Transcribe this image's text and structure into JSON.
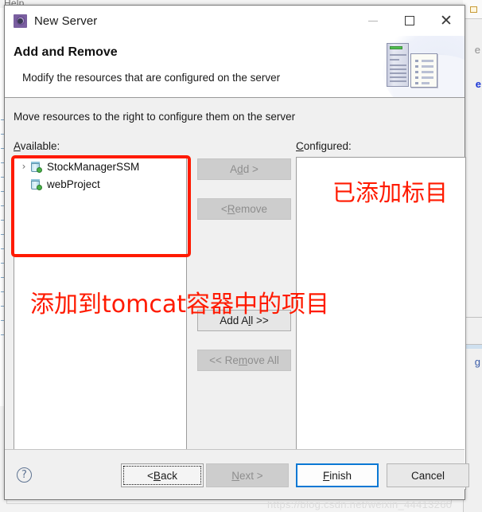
{
  "background": {
    "menu_help": "Help",
    "right_glyph_1": "e",
    "right_glyph_2": "e",
    "right_glyph_3": "g"
  },
  "window": {
    "title": "New Server",
    "icon": "server-wizard-icon",
    "controls": {
      "minimize": "minimize-icon",
      "maximize": "maximize-icon",
      "close": "close-icon"
    }
  },
  "header": {
    "title": "Add and Remove",
    "subtitle": "Modify the resources that are configured on the server",
    "art_icon": "server-rack-and-document-icon"
  },
  "main": {
    "instruction": "Move resources to the right to configure them on the server",
    "available": {
      "label": "Available:",
      "label_mnemonic": "A",
      "label_rest": "vailable:",
      "items": [
        {
          "name": "StockManagerSSM",
          "expandable": true,
          "twisty": "›",
          "icon": "project-jar-icon"
        },
        {
          "name": "webProject",
          "expandable": false,
          "twisty": "›",
          "icon": "project-jar-icon"
        }
      ]
    },
    "configured": {
      "label": "Configured:",
      "label_mnemonic": "C",
      "label_rest": "onfigured:",
      "items": []
    },
    "buttons": {
      "add": {
        "pre": "A",
        "mn": "d",
        "post": "d >",
        "label": "Add >",
        "enabled": false
      },
      "remove": {
        "pre": "< ",
        "mn": "R",
        "post": "emove",
        "label": "< Remove",
        "enabled": false
      },
      "add_all": {
        "pre": "Add A",
        "mn": "l",
        "post": "l >>",
        "label": "Add All >>",
        "enabled": true
      },
      "remove_all": {
        "pre": "<< Re",
        "mn": "m",
        "post": "ove All",
        "label": "<< Remove All",
        "enabled": false
      }
    }
  },
  "annotations": {
    "box_color": "#ff1a00",
    "left_text": "添加到tomcat容器中的项目",
    "right_text": "已添加标目"
  },
  "footer": {
    "help": "?",
    "back": {
      "pre": "< ",
      "mn": "B",
      "post": "ack",
      "label": "< Back",
      "state": "focused"
    },
    "next": {
      "pre": "",
      "mn": "N",
      "post": "ext >",
      "label": "Next >",
      "state": "disabled"
    },
    "finish": {
      "pre": "",
      "mn": "F",
      "post": "inish",
      "label": "Finish",
      "state": "default"
    },
    "cancel": {
      "pre": "",
      "mn": "",
      "post": "Cancel",
      "label": "Cancel",
      "state": "normal"
    },
    "watermark": "https://blog.csdn.net/weixin_44413260"
  },
  "colors": {
    "accent": "#0a78d4",
    "annotation": "#ff1a00",
    "dialog_bg": "#f0f0f0",
    "title_icon": "#7a5fa0"
  }
}
